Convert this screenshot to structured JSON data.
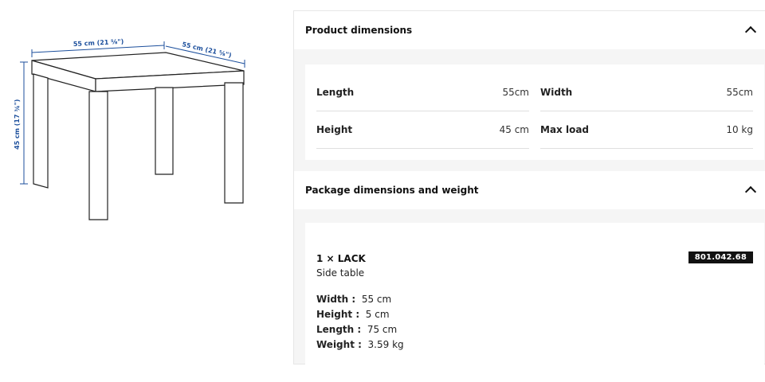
{
  "illustration": {
    "top_width_label": "55 cm (21 ⅝\")",
    "depth_label": "55 cm (21 ⅝\")",
    "height_label": "45 cm (17 ¾\")"
  },
  "product_dimensions": {
    "title": "Product dimensions",
    "rows": [
      {
        "key": "Length",
        "value": "55cm"
      },
      {
        "key": "Width",
        "value": "55cm"
      },
      {
        "key": "Height",
        "value": "45 cm"
      },
      {
        "key": "Max load",
        "value": "10 kg"
      }
    ]
  },
  "package": {
    "title": "Package dimensions and weight",
    "item_name": "1 × LACK",
    "item_type": "Side table",
    "article_number": "801.042.68",
    "specs": [
      {
        "key": "Width :",
        "value": "55 cm"
      },
      {
        "key": "Height :",
        "value": "5 cm"
      },
      {
        "key": "Length :",
        "value": "75 cm"
      },
      {
        "key": "Weight :",
        "value": "3.59 kg"
      }
    ]
  }
}
